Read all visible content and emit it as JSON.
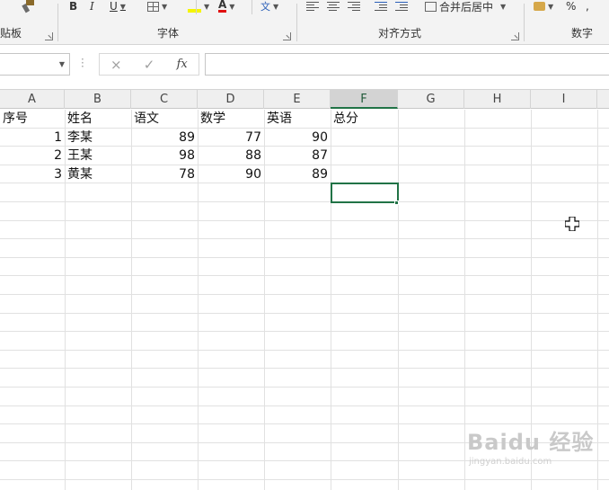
{
  "ribbon": {
    "clipboard_group_label": "贴板",
    "font_group_label": "字体",
    "alignment_group_label": "对齐方式",
    "number_group_label": "数字",
    "bold_label": "B",
    "italic_label": "I",
    "underline_label": "U",
    "font_color_label": "A",
    "wrap_label": "文",
    "merge_center_label": "合并后居中",
    "percent_label": "%",
    "accent_color": "#217346"
  },
  "formula_bar": {
    "name_box_value": "",
    "cancel_icon": "×",
    "enter_icon": "✓",
    "function_label": "fx",
    "formula_value": ""
  },
  "sheet": {
    "columns": [
      "A",
      "B",
      "C",
      "D",
      "E",
      "F",
      "G",
      "H",
      "I"
    ],
    "selected_column": "F",
    "rows": [
      {
        "A": "序号",
        "B": "姓名",
        "C": "语文",
        "D": "数学",
        "E": "英语",
        "F": "总分"
      },
      {
        "A": "1",
        "B": "李某",
        "C": "89",
        "D": "77",
        "E": "90",
        "F": ""
      },
      {
        "A": "2",
        "B": "王某",
        "C": "98",
        "D": "88",
        "E": "87",
        "F": ""
      },
      {
        "A": "3",
        "B": "黄某",
        "C": "78",
        "D": "90",
        "E": "89",
        "F": ""
      }
    ],
    "active_cell": "F5",
    "gridline_color": "#e1e1e1"
  },
  "watermark": {
    "logo_text": "Baidu 经验",
    "sub_text": "jingyan.baidu.com"
  }
}
